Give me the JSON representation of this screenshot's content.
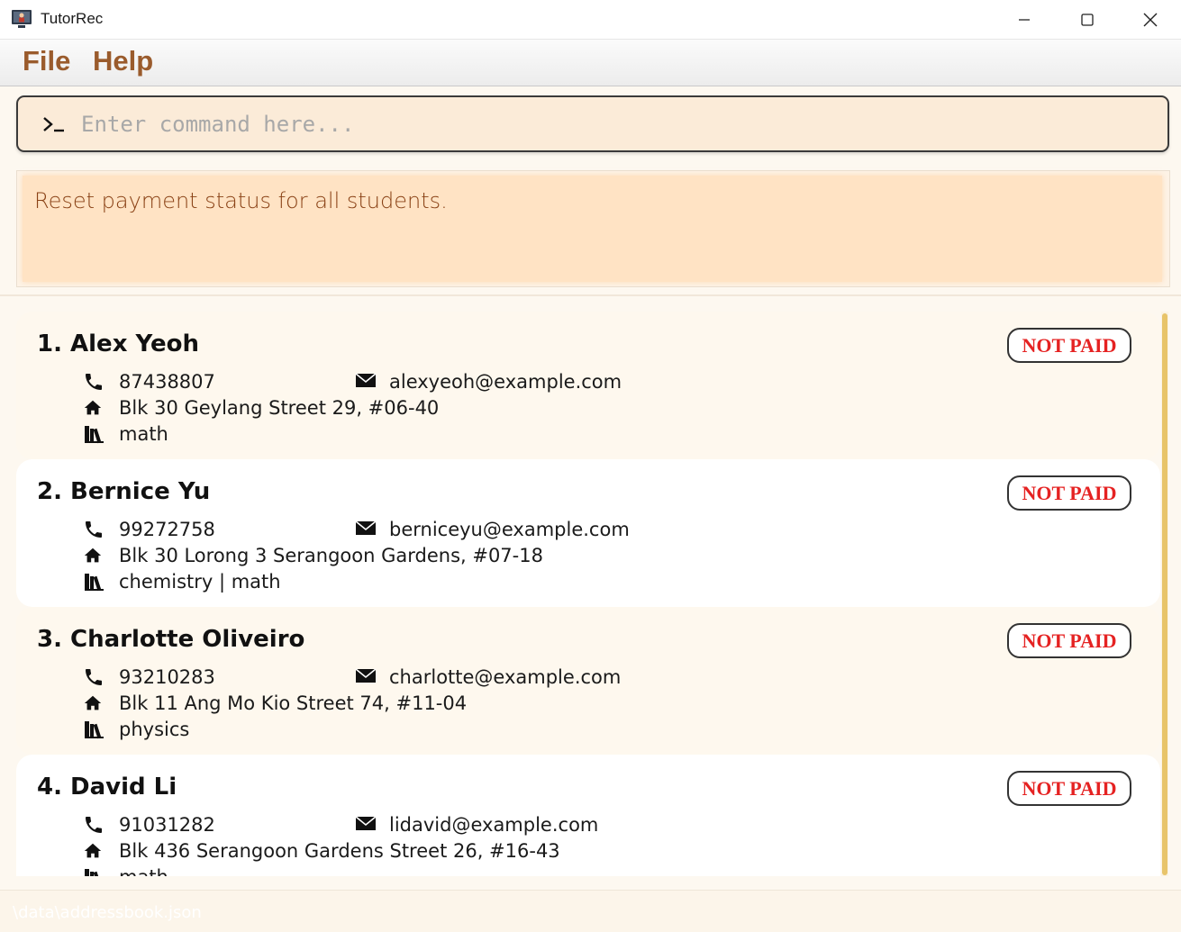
{
  "window": {
    "title": "TutorRec",
    "icon": "app-icon",
    "controls": [
      "minimize-icon",
      "maximize-icon",
      "close-icon"
    ]
  },
  "menu": {
    "file_label": "File",
    "help_label": "Help"
  },
  "command": {
    "prompt_symbol": ">_",
    "placeholder": "Enter command here...",
    "value": ""
  },
  "result": {
    "message": "Reset payment status for all students."
  },
  "students": [
    {
      "name": "1. Alex Yeoh",
      "phone": "87438807",
      "email": "alexyeoh@example.com",
      "address": "Blk 30 Geylang Street 29, #06-40",
      "subjects": "math",
      "status": "NOT PAID"
    },
    {
      "name": "2. Bernice Yu",
      "phone": "99272758",
      "email": "berniceyu@example.com",
      "address": "Blk 30 Lorong 3 Serangoon Gardens, #07-18",
      "subjects": "chemistry | math",
      "status": "NOT PAID"
    },
    {
      "name": "3. Charlotte Oliveiro",
      "phone": "93210283",
      "email": "charlotte@example.com",
      "address": "Blk 11 Ang Mo Kio Street 74, #11-04",
      "subjects": "physics",
      "status": "NOT PAID"
    },
    {
      "name": "4. David Li",
      "phone": "91031282",
      "email": "lidavid@example.com",
      "address": "Blk 436 Serangoon Gardens Street 26, #16-43",
      "subjects": "math",
      "status": "NOT PAID"
    }
  ],
  "icons": {
    "phone": "phone-icon",
    "email": "envelope-icon",
    "address": "home-icon",
    "subjects": "books-icon"
  },
  "statusbar": {
    "path": "\\data\\addressbook.json"
  },
  "colors": {
    "menu_text": "#9a5b2c",
    "command_bg": "#fbebd8",
    "result_bg": "#ffe3c4",
    "result_text": "#8a4216",
    "badge_text": "#e52222",
    "scroll_thumb": "#e8c46a"
  }
}
